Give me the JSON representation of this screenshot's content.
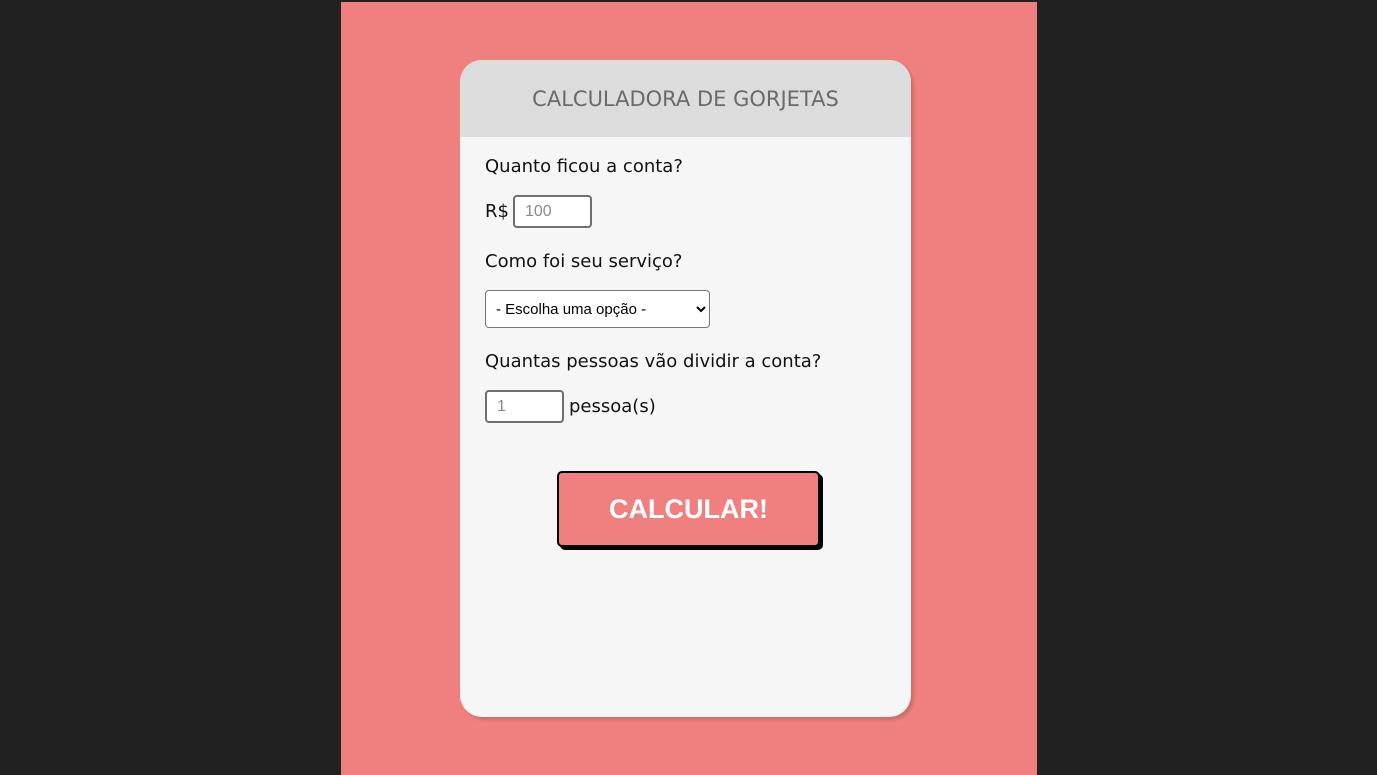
{
  "app": {
    "title": "CALCULADORA DE GORJETAS"
  },
  "form": {
    "bill_question": "Quanto ficou a conta?",
    "currency_label": "R$",
    "bill_placeholder": "100",
    "service_question": "Como foi seu serviço?",
    "service_selected": "- Escolha uma opção -",
    "people_question": "Quantas pessoas vão dividir a conta?",
    "people_placeholder": "1",
    "people_unit": "pessoa(s)",
    "calculate_label": "CALCULAR!"
  },
  "colors": {
    "background": "#212121",
    "page": "#f08080",
    "card": "#f6f6f6",
    "header": "#dcdcdc",
    "button": "#f08080"
  }
}
